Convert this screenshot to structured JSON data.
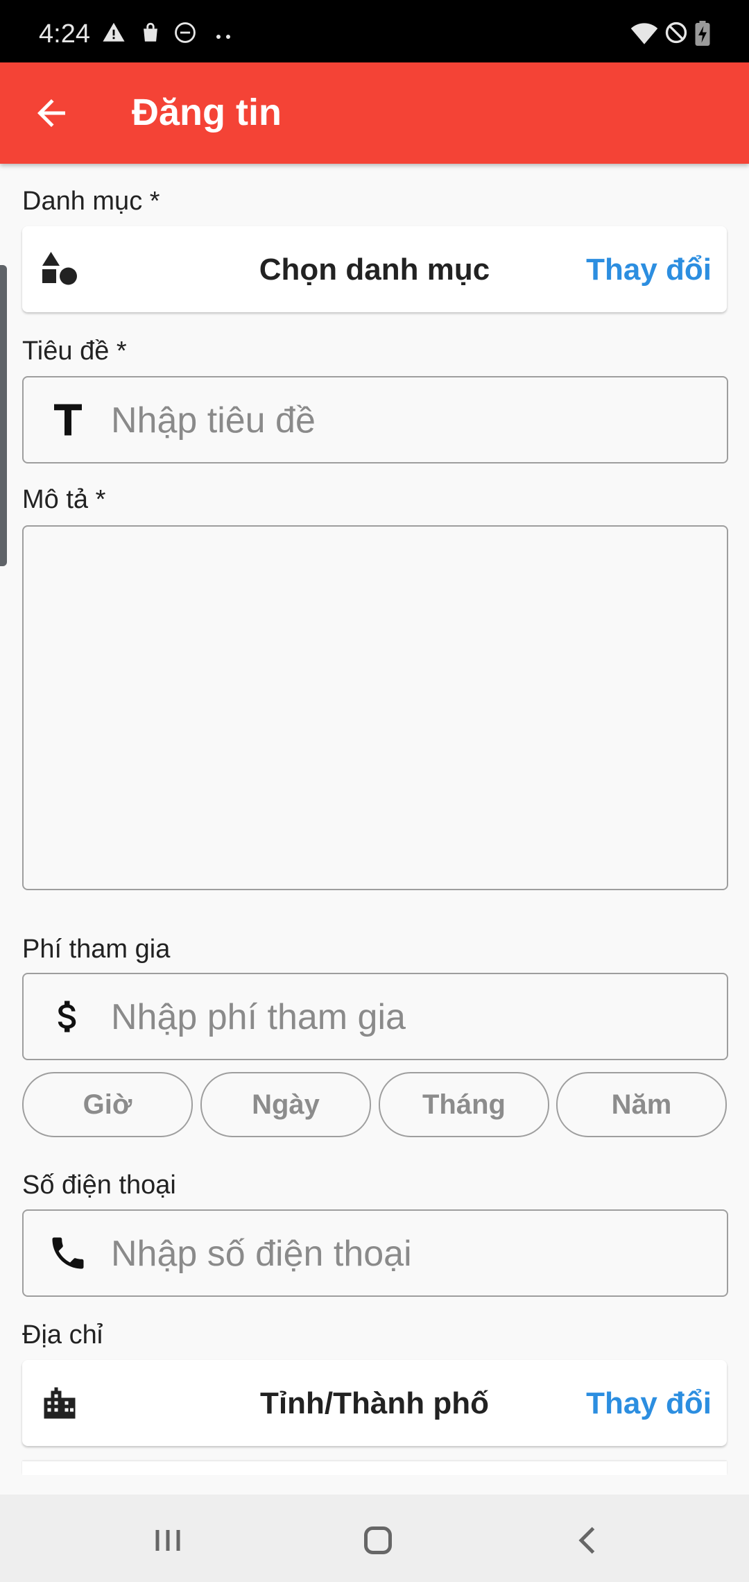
{
  "status_bar": {
    "time": "4:24",
    "left_icons": [
      "warning-icon",
      "shopping-bag-icon",
      "do-not-disturb-icon",
      "more-dots-icon"
    ],
    "right_icons": [
      "wifi-icon",
      "blocked-icon",
      "battery-charging-icon"
    ]
  },
  "app_bar": {
    "title": "Đăng tin",
    "color": "#f44336"
  },
  "category": {
    "label": "Danh mục *",
    "value": "Chọn danh mục",
    "change_label": "Thay đổi",
    "icon": "shapes-icon"
  },
  "title_field": {
    "label": "Tiêu đề *",
    "placeholder": "Nhập tiêu đề",
    "icon": "text-format-icon"
  },
  "description_field": {
    "label": "Mô tả *",
    "value": ""
  },
  "fee_field": {
    "label": "Phí tham gia",
    "placeholder": "Nhập phí tham gia",
    "icon": "dollar-icon",
    "units": [
      "Giờ",
      "Ngày",
      "Tháng",
      "Năm"
    ]
  },
  "phone_field": {
    "label": "Số điện thoại",
    "placeholder": "Nhập số điện thoại",
    "icon": "phone-icon"
  },
  "address": {
    "label": "Địa chỉ",
    "province_value": "Tỉnh/Thành phố",
    "change_label": "Thay đổi",
    "icon": "city-icon"
  },
  "colors": {
    "accent_link": "#2c8ee0",
    "field_border": "#9e9e9e",
    "background": "#f9f9f9"
  },
  "nav_bar": {
    "icons": [
      "recent-apps-icon",
      "home-icon",
      "back-icon"
    ]
  }
}
